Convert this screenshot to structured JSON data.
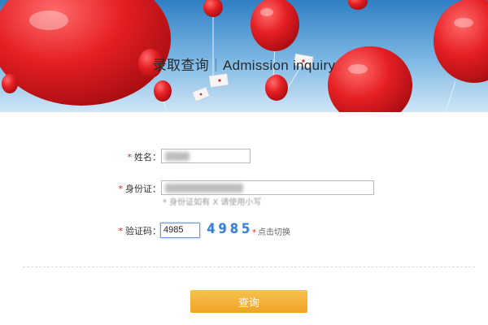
{
  "banner": {
    "title_cn": "录取查询",
    "title_en": "Admission inquiry"
  },
  "form": {
    "required_mark": "*",
    "name": {
      "label": "姓名：",
      "value": ""
    },
    "id_card": {
      "label": "身份证：",
      "value": "",
      "hint": "* 身份证如有 X 请使用小写"
    },
    "captcha": {
      "label": "验证码：",
      "value": "4985",
      "code": "4985",
      "refresh_mark": "*",
      "refresh_label": "点击切换"
    }
  },
  "submit_label": "查询",
  "colors": {
    "accent_button": "#f0a325",
    "required": "#d52b2b",
    "captcha": "#3b7fd0"
  }
}
